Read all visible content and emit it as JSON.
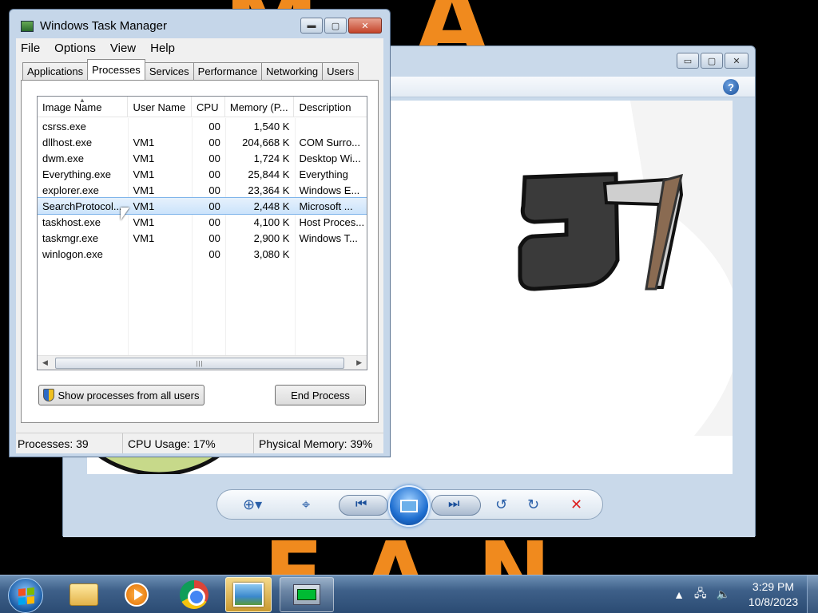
{
  "wallpaper": {
    "top_letters": "MA A",
    "bottom_letters": "FAN"
  },
  "viewer": {
    "caption": {
      "minimize": "▭",
      "maximize": "▢",
      "close": "✕"
    },
    "help_label": "?",
    "controls": {
      "zoom": "⊕▾",
      "fit": "⌖",
      "prev": "⏮",
      "next": "⏭",
      "rotate_ccw": "↺",
      "rotate_cw": "↻",
      "delete": "✕"
    },
    "icons": [
      "zoom-icon",
      "fit-icon",
      "previous-icon",
      "slideshow-icon",
      "next-icon",
      "rotate-ccw-icon",
      "rotate-cw-icon",
      "delete-icon"
    ]
  },
  "taskmgr": {
    "title": "Windows Task Manager",
    "caption": {
      "minimize": "▬",
      "maximize": "▢",
      "close": "✕"
    },
    "menu": [
      "File",
      "Options",
      "View",
      "Help"
    ],
    "tabs": [
      "Applications",
      "Processes",
      "Services",
      "Performance",
      "Networking",
      "Users"
    ],
    "active_tab": "Processes",
    "columns": [
      "Image Name",
      "User Name",
      "CPU",
      "Memory (P...",
      "Description"
    ],
    "rows": [
      {
        "image": "csrss.exe",
        "user": "",
        "cpu": "00",
        "mem": "1,540 K",
        "desc": ""
      },
      {
        "image": "dllhost.exe",
        "user": "VM1",
        "cpu": "00",
        "mem": "204,668 K",
        "desc": "COM Surro..."
      },
      {
        "image": "dwm.exe",
        "user": "VM1",
        "cpu": "00",
        "mem": "1,724 K",
        "desc": "Desktop Wi..."
      },
      {
        "image": "Everything.exe",
        "user": "VM1",
        "cpu": "00",
        "mem": "25,844 K",
        "desc": "Everything"
      },
      {
        "image": "explorer.exe",
        "user": "VM1",
        "cpu": "00",
        "mem": "23,364 K",
        "desc": "Windows E..."
      },
      {
        "image": "SearchProtocol...",
        "user": "VM1",
        "cpu": "00",
        "mem": "2,448 K",
        "desc": "Microsoft ..."
      },
      {
        "image": "taskhost.exe",
        "user": "VM1",
        "cpu": "00",
        "mem": "4,100 K",
        "desc": "Host Proces..."
      },
      {
        "image": "taskmgr.exe",
        "user": "VM1",
        "cpu": "00",
        "mem": "2,900 K",
        "desc": "Windows T..."
      },
      {
        "image": "winlogon.exe",
        "user": "",
        "cpu": "00",
        "mem": "3,080 K",
        "desc": ""
      }
    ],
    "selected_row": 5,
    "show_all_button": "Show processes from all users",
    "end_process_button": "End Process",
    "status": {
      "processes": "Processes: 39",
      "cpu": "CPU Usage: 17%",
      "memory": "Physical Memory: 39%"
    }
  },
  "taskbar": {
    "pinned": [
      "windows-explorer",
      "windows-media-player",
      "google-chrome",
      "windows-photo-viewer",
      "task-manager"
    ],
    "clock_time": "3:29 PM",
    "clock_date": "10/8/2023",
    "tray": {
      "show_hidden": "▲",
      "network": "🖧",
      "volume": "🔈"
    }
  }
}
